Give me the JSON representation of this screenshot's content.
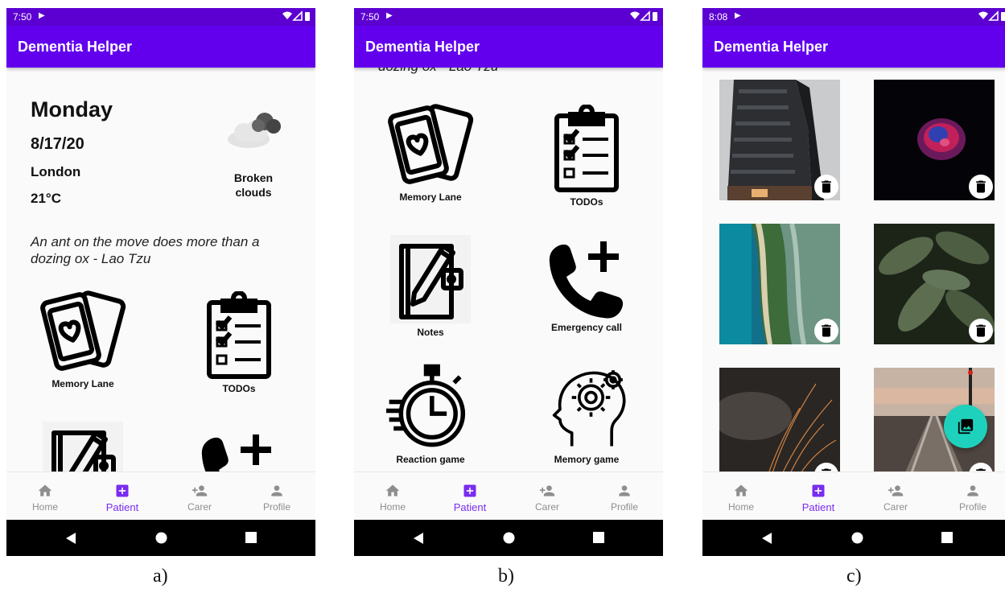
{
  "phones": [
    {
      "status_time": "7:50",
      "app_title": "Dementia Helper",
      "nav": [
        {
          "label": "Home"
        },
        {
          "label": "Patient"
        },
        {
          "label": "Carer"
        },
        {
          "label": "Profile"
        }
      ]
    },
    {
      "status_time": "7:50",
      "app_title": "Dementia Helper",
      "nav": [
        {
          "label": "Home"
        },
        {
          "label": "Patient"
        },
        {
          "label": "Carer"
        },
        {
          "label": "Profile"
        }
      ]
    },
    {
      "status_time": "8:08",
      "app_title": "Dementia Helper",
      "nav": [
        {
          "label": "Home"
        },
        {
          "label": "Patient"
        },
        {
          "label": "Carer"
        },
        {
          "label": "Profile"
        }
      ]
    }
  ],
  "screen_a": {
    "day": "Monday",
    "date": "8/17/20",
    "city": "London",
    "temperature": "21°C",
    "weather_description": "Broken clouds",
    "quote": "An ant on the move does more than a dozing ox - Lao Tzu",
    "tiles": [
      {
        "label": "Memory Lane",
        "icon": "cards-heart-icon"
      },
      {
        "label": "TODOs",
        "icon": "clipboard-checklist-icon"
      },
      {
        "label": "",
        "icon": "notebook-pen-icon"
      },
      {
        "label": "",
        "icon": "phone-plus-icon"
      }
    ]
  },
  "screen_b": {
    "quote_fragment": "dozing ox - Lao Tzu",
    "tiles": [
      {
        "label": "Memory Lane",
        "icon": "cards-heart-icon"
      },
      {
        "label": "TODOs",
        "icon": "clipboard-checklist-icon"
      },
      {
        "label": "Notes",
        "icon": "notebook-pen-icon"
      },
      {
        "label": "Emergency call",
        "icon": "phone-plus-icon"
      },
      {
        "label": "Reaction game",
        "icon": "stopwatch-icon"
      },
      {
        "label": "Memory game",
        "icon": "head-gears-icon"
      }
    ]
  },
  "screen_c": {
    "photos": [
      {
        "subject": "building"
      },
      {
        "subject": "jellyfish"
      },
      {
        "subject": "coastline"
      },
      {
        "subject": "leaves"
      },
      {
        "subject": "sparks"
      },
      {
        "subject": "railway"
      }
    ],
    "fab_icon": "add-photo-icon"
  },
  "captions": [
    "a)",
    "b)",
    "c)"
  ],
  "colors": {
    "primary": "#6200ee",
    "status_bar": "#5c00d2",
    "nav_active": "#7a2cf0",
    "nav_inactive": "#8e8e8e",
    "fab": "#1ed1bd"
  }
}
